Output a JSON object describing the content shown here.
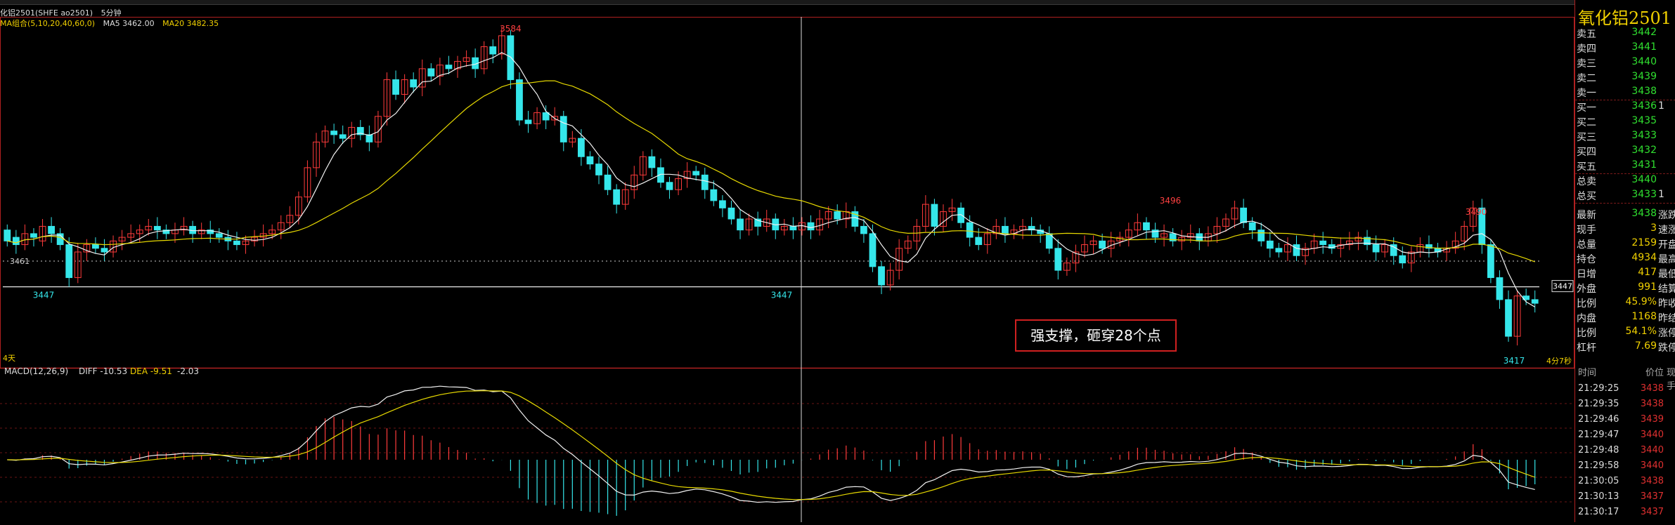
{
  "header": {
    "symbol": "化铝2501(SHFE ao2501)",
    "period": "5分钟",
    "ma_group": "MA组合(5,10,20,40,60,0)",
    "ma5": "MA5 3462.00",
    "ma20": "MA20 3482.35"
  },
  "price_axis": {
    "dotted_level": "3461",
    "support_price": "3447",
    "support_tag": "3447"
  },
  "labels": {
    "high_main": "3584",
    "low_left": "3447",
    "low_mid": "3447",
    "peak2": "3496",
    "peak3": "3490",
    "low_right": "3417",
    "corner_left": "4天",
    "corner_right": "4分7秒"
  },
  "macd": {
    "title": "MACD(12,26,9)",
    "diff": "DIFF -10.53",
    "dea": "DEA -9.51",
    "hist": "-2.03"
  },
  "annotation": "强支撑，砸穿28个点",
  "panel": {
    "title": "氧化铝2501 a",
    "asks": [
      {
        "label": "卖五",
        "price": "3442"
      },
      {
        "label": "卖四",
        "price": "3441"
      },
      {
        "label": "卖三",
        "price": "3440"
      },
      {
        "label": "卖二",
        "price": "3439"
      },
      {
        "label": "卖一",
        "price": "3438"
      }
    ],
    "bids": [
      {
        "label": "买一",
        "price": "3436",
        "extra": "1"
      },
      {
        "label": "买二",
        "price": "3435",
        "extra": ""
      },
      {
        "label": "买三",
        "price": "3433",
        "extra": ""
      },
      {
        "label": "买四",
        "price": "3432",
        "extra": ""
      },
      {
        "label": "买五",
        "price": "3431",
        "extra": ""
      }
    ],
    "totals": [
      {
        "label": "总卖",
        "price": "3440",
        "extra": ""
      },
      {
        "label": "总买",
        "price": "3433",
        "extra": "1"
      }
    ],
    "stats": [
      {
        "label": "最新",
        "value": "3438",
        "color": "#30e030",
        "extra": "涨跌"
      },
      {
        "label": "现手",
        "value": "3",
        "color": "#f0d000",
        "extra": "速涨"
      },
      {
        "label": "总量",
        "value": "2159",
        "color": "#f0d000",
        "extra": "开盘"
      },
      {
        "label": "持仓",
        "value": "4934",
        "color": "#f0d000",
        "extra": "最高"
      },
      {
        "label": "日增",
        "value": "417",
        "color": "#f0d000",
        "extra": "最低"
      },
      {
        "label": "外盘",
        "value": "991",
        "color": "#f0d000",
        "extra": "结算"
      },
      {
        "label": "比例",
        "value": "45.9%",
        "color": "#f0d000",
        "extra": "昨收"
      },
      {
        "label": "内盘",
        "value": "1168",
        "color": "#f0d000",
        "extra": "昨结"
      },
      {
        "label": "比例",
        "value": "54.1%",
        "color": "#f0d000",
        "extra": "涨停"
      },
      {
        "label": "杠杆",
        "value": "7.69",
        "color": "#f0d000",
        "extra": "跌停"
      }
    ],
    "ticks_header": {
      "time": "时间",
      "price": "价位",
      "vol": "现手"
    },
    "ticks": [
      {
        "time": "21:29:25",
        "price": "3438"
      },
      {
        "time": "21:29:35",
        "price": "3438"
      },
      {
        "time": "21:29:46",
        "price": "3439"
      },
      {
        "time": "21:29:47",
        "price": "3440"
      },
      {
        "time": "21:29:48",
        "price": "3440"
      },
      {
        "time": "21:29:58",
        "price": "3440"
      },
      {
        "time": "21:30:05",
        "price": "3438"
      },
      {
        "time": "21:30:13",
        "price": "3437"
      },
      {
        "time": "21:30:17",
        "price": "3437"
      }
    ]
  },
  "chart_data": {
    "type": "candlestick",
    "period": "5分钟",
    "bars_open_close": [
      [
        3478,
        3472
      ],
      [
        3474,
        3470
      ],
      [
        3470,
        3476
      ],
      [
        3476,
        3474
      ],
      [
        3472,
        3480
      ],
      [
        3480,
        3476
      ],
      [
        3476,
        3470
      ],
      [
        3470,
        3452
      ],
      [
        3452,
        3466
      ],
      [
        3466,
        3470
      ],
      [
        3470,
        3468
      ],
      [
        3468,
        3466
      ],
      [
        3466,
        3472
      ],
      [
        3472,
        3474
      ],
      [
        3474,
        3476
      ],
      [
        3476,
        3478
      ],
      [
        3478,
        3480
      ],
      [
        3480,
        3478
      ],
      [
        3478,
        3476
      ],
      [
        3476,
        3478
      ],
      [
        3478,
        3480
      ],
      [
        3480,
        3476
      ],
      [
        3476,
        3478
      ],
      [
        3478,
        3476
      ],
      [
        3476,
        3474
      ],
      [
        3474,
        3472
      ],
      [
        3472,
        3470
      ],
      [
        3470,
        3472
      ],
      [
        3472,
        3474
      ],
      [
        3474,
        3476
      ],
      [
        3476,
        3478
      ],
      [
        3478,
        3482
      ],
      [
        3482,
        3486
      ],
      [
        3486,
        3496
      ],
      [
        3496,
        3512
      ],
      [
        3512,
        3526
      ],
      [
        3526,
        3532
      ],
      [
        3532,
        3530
      ],
      [
        3530,
        3528
      ],
      [
        3528,
        3534
      ],
      [
        3534,
        3530
      ],
      [
        3530,
        3526
      ],
      [
        3526,
        3540
      ],
      [
        3540,
        3560
      ],
      [
        3560,
        3552
      ],
      [
        3552,
        3560
      ],
      [
        3560,
        3556
      ],
      [
        3556,
        3566
      ],
      [
        3566,
        3562
      ],
      [
        3562,
        3568
      ],
      [
        3568,
        3566
      ],
      [
        3566,
        3570
      ],
      [
        3570,
        3572
      ],
      [
        3572,
        3566
      ],
      [
        3566,
        3578
      ],
      [
        3578,
        3574
      ],
      [
        3574,
        3584
      ],
      [
        3584,
        3560
      ],
      [
        3560,
        3538
      ],
      [
        3538,
        3536
      ],
      [
        3536,
        3542
      ],
      [
        3542,
        3538
      ],
      [
        3538,
        3540
      ],
      [
        3540,
        3526
      ],
      [
        3526,
        3528
      ],
      [
        3528,
        3518
      ],
      [
        3518,
        3514
      ],
      [
        3514,
        3508
      ],
      [
        3508,
        3500
      ],
      [
        3500,
        3492
      ],
      [
        3492,
        3500
      ],
      [
        3500,
        3508
      ],
      [
        3508,
        3518
      ],
      [
        3518,
        3512
      ],
      [
        3512,
        3504
      ],
      [
        3504,
        3500
      ],
      [
        3500,
        3506
      ],
      [
        3506,
        3510
      ],
      [
        3510,
        3508
      ],
      [
        3508,
        3500
      ],
      [
        3500,
        3494
      ],
      [
        3494,
        3490
      ],
      [
        3490,
        3484
      ],
      [
        3484,
        3478
      ],
      [
        3478,
        3484
      ],
      [
        3484,
        3480
      ],
      [
        3480,
        3484
      ],
      [
        3484,
        3478
      ],
      [
        3478,
        3480
      ],
      [
        3480,
        3478
      ],
      [
        3478,
        3482
      ],
      [
        3482,
        3478
      ],
      [
        3478,
        3484
      ],
      [
        3484,
        3488
      ],
      [
        3488,
        3484
      ],
      [
        3484,
        3488
      ],
      [
        3488,
        3480
      ],
      [
        3480,
        3476
      ],
      [
        3476,
        3458
      ],
      [
        3458,
        3448
      ],
      [
        3448,
        3456
      ],
      [
        3456,
        3468
      ],
      [
        3468,
        3472
      ],
      [
        3472,
        3480
      ],
      [
        3480,
        3492
      ],
      [
        3492,
        3480
      ],
      [
        3480,
        3488
      ],
      [
        3488,
        3490
      ],
      [
        3490,
        3482
      ],
      [
        3482,
        3474
      ],
      [
        3474,
        3470
      ],
      [
        3470,
        3476
      ],
      [
        3476,
        3480
      ],
      [
        3480,
        3476
      ],
      [
        3476,
        3478
      ],
      [
        3478,
        3480
      ],
      [
        3480,
        3478
      ],
      [
        3478,
        3476
      ],
      [
        3476,
        3468
      ],
      [
        3468,
        3456
      ],
      [
        3456,
        3460
      ],
      [
        3460,
        3466
      ],
      [
        3466,
        3470
      ],
      [
        3470,
        3472
      ],
      [
        3472,
        3468
      ],
      [
        3468,
        3472
      ],
      [
        3472,
        3474
      ],
      [
        3474,
        3478
      ],
      [
        3478,
        3482
      ],
      [
        3482,
        3478
      ],
      [
        3478,
        3474
      ],
      [
        3474,
        3476
      ],
      [
        3476,
        3472
      ],
      [
        3472,
        3474
      ],
      [
        3474,
        3476
      ],
      [
        3476,
        3472
      ],
      [
        3472,
        3476
      ],
      [
        3476,
        3480
      ],
      [
        3480,
        3484
      ],
      [
        3484,
        3490
      ],
      [
        3490,
        3482
      ],
      [
        3482,
        3478
      ],
      [
        3478,
        3472
      ],
      [
        3472,
        3468
      ],
      [
        3468,
        3466
      ],
      [
        3466,
        3470
      ],
      [
        3470,
        3464
      ],
      [
        3464,
        3468
      ],
      [
        3468,
        3472
      ],
      [
        3472,
        3470
      ],
      [
        3470,
        3468
      ],
      [
        3468,
        3470
      ],
      [
        3470,
        3472
      ],
      [
        3472,
        3474
      ],
      [
        3474,
        3470
      ],
      [
        3470,
        3466
      ],
      [
        3466,
        3470
      ],
      [
        3470,
        3464
      ],
      [
        3464,
        3460
      ],
      [
        3460,
        3466
      ],
      [
        3466,
        3470
      ],
      [
        3470,
        3468
      ],
      [
        3468,
        3466
      ],
      [
        3466,
        3468
      ],
      [
        3468,
        3472
      ],
      [
        3472,
        3480
      ],
      [
        3480,
        3490
      ],
      [
        3490,
        3470
      ],
      [
        3470,
        3452
      ],
      [
        3452,
        3440
      ],
      [
        3440,
        3420
      ],
      [
        3420,
        3442
      ],
      [
        3442,
        3440
      ],
      [
        3440,
        3438
      ]
    ],
    "high": 3584,
    "low": 3417,
    "dotted_level": 3461,
    "support_line": 3447
  }
}
